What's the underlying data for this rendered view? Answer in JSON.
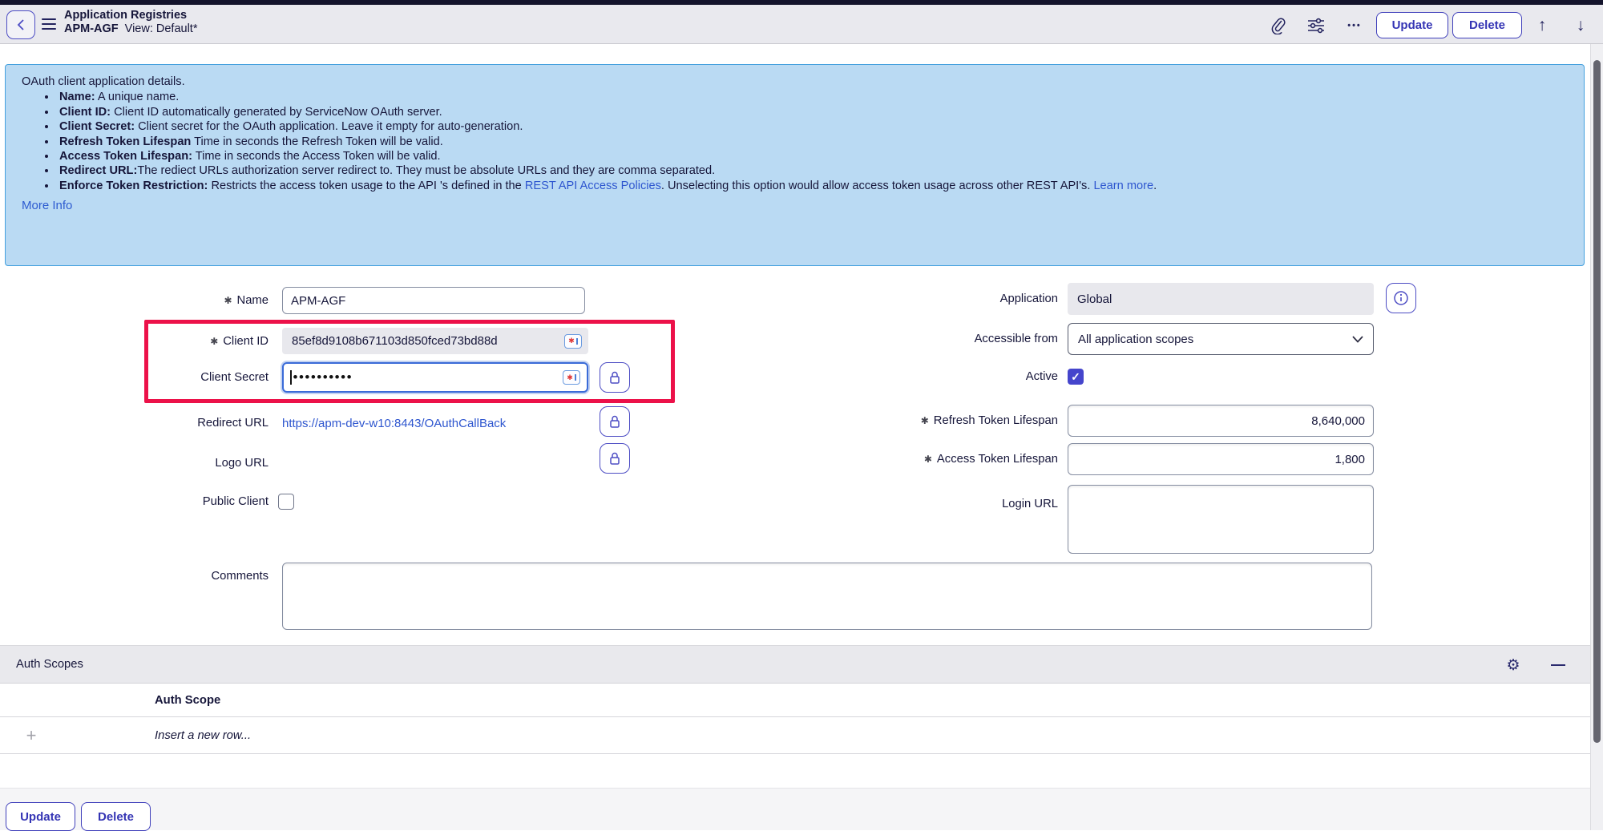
{
  "colors": {
    "accent_indigo": "#4040bb",
    "link_blue": "#2e56cf",
    "highlight_red": "#ec1149",
    "info_box_bg": "#badaf3",
    "info_box_border": "#44a0de",
    "header_bg": "#e9e9ee",
    "text": "#16163a",
    "readonly_bg": "#e8e8ed",
    "checked_checkbox": "#4545cc"
  },
  "header": {
    "title": "Application Registries",
    "record_name": "APM-AGF",
    "view_label": "View: Default*",
    "more_icon": "•••",
    "update_label": "Update",
    "delete_label": "Delete",
    "up_arrow": "↑",
    "down_arrow": "↓"
  },
  "info_box": {
    "intro": "OAuth client application details.",
    "bullets": [
      {
        "bold": "Name:",
        "rest": " A unique name."
      },
      {
        "bold": "Client ID:",
        "rest": " Client ID automatically generated by ServiceNow OAuth server."
      },
      {
        "bold": "Client Secret:",
        "rest": " Client secret for the OAuth application. Leave it empty for auto-generation."
      },
      {
        "bold": "Refresh Token Lifespan",
        "rest": " Time in seconds the Refresh Token will be valid."
      },
      {
        "bold": "Access Token Lifespan:",
        "rest": " Time in seconds the Access Token will be valid."
      },
      {
        "bold": "Redirect URL:",
        "rest": "The rediect URLs authorization server redirect to. They must be absolute URLs and they are comma separated."
      },
      {
        "bold": "Enforce Token Restriction:",
        "rest": " Restricts the access token usage to the API 's defined in the ",
        "link": "REST API Access Policies",
        "rest2": ". Unselecting this option would allow access token usage across other REST API's. ",
        "link2": "Learn more",
        "rest3": "."
      }
    ],
    "more_info": "More Info"
  },
  "form": {
    "required_marker": "✱",
    "name_label": "Name",
    "name_value": "APM-AGF",
    "client_id_label": "Client ID",
    "client_id_value": "85ef8d9108b671103d850fced73bd88d",
    "client_secret_label": "Client Secret",
    "client_secret_value": "••••••••••",
    "redirect_label": "Redirect URL",
    "redirect_value": "https://apm-dev-w10:8443/OAuthCallBack",
    "logo_label": "Logo URL",
    "public_client_label": "Public Client",
    "comments_label": "Comments",
    "application_label": "Application",
    "application_value": "Global",
    "accessible_label": "Accessible from",
    "accessible_value": "All application scopes",
    "active_label": "Active",
    "active_check": "✓",
    "refresh_label": "Refresh Token Lifespan",
    "refresh_value": "8,640,000",
    "access_label": "Access Token Lifespan",
    "access_value": "1,800",
    "login_label": "Login URL"
  },
  "auth_scopes": {
    "title": "Auth Scopes",
    "gear_icon": "⚙",
    "column_header": "Auth Scope",
    "plus_icon": "+",
    "insert_row_label": "Insert a new row..."
  },
  "footer": {
    "update_label": "Update",
    "delete_label": "Delete"
  }
}
